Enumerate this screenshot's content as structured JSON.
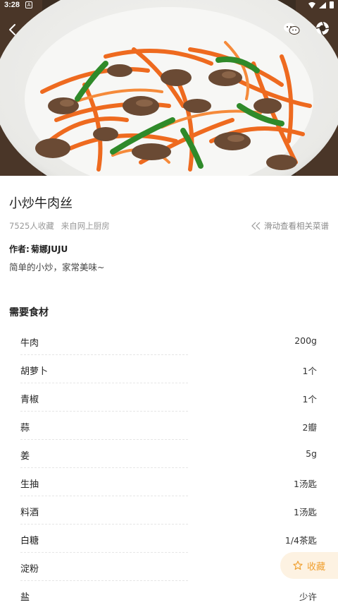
{
  "status_bar": {
    "time": "3:28",
    "badge": "A"
  },
  "recipe": {
    "title": "小炒牛肉丝",
    "favorites": "7525人收藏",
    "source": "来自网上厨房",
    "related_hint": "滑动查看相关菜谱",
    "author_label": "作者:",
    "author_name": "菊娜JUJU",
    "description": "简单的小炒，家常美味~"
  },
  "ingredients": {
    "title": "需要食材",
    "items": [
      {
        "name": "牛肉",
        "amount": "200g"
      },
      {
        "name": "胡萝卜",
        "amount": "1个"
      },
      {
        "name": "青椒",
        "amount": "1个"
      },
      {
        "name": "蒜",
        "amount": "2瓣"
      },
      {
        "name": "姜",
        "amount": "5g"
      },
      {
        "name": "生抽",
        "amount": "1汤匙"
      },
      {
        "name": "料酒",
        "amount": "1汤匙"
      },
      {
        "name": "白糖",
        "amount": "1/4茶匙"
      },
      {
        "name": "淀粉",
        "amount": ""
      },
      {
        "name": "盐",
        "amount": "少许"
      }
    ]
  },
  "favorite_button": {
    "label": "收藏"
  },
  "colors": {
    "accent": "#f0a030",
    "fav_bg": "#fdf2e2"
  }
}
